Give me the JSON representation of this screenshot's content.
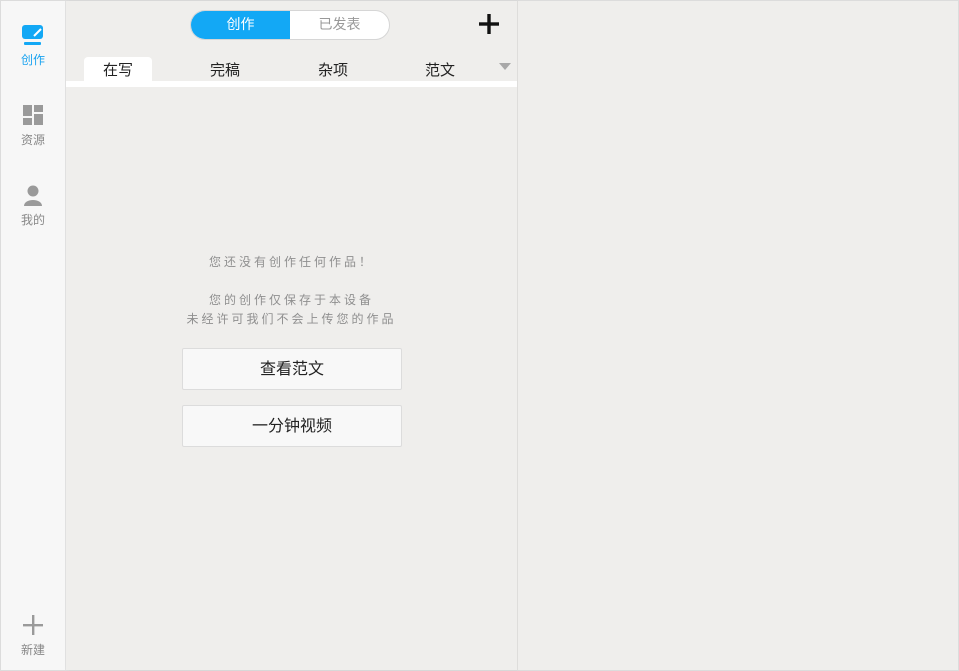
{
  "colors": {
    "accent": "#13a8f5",
    "icon_gray": "#999999"
  },
  "rail": {
    "items": [
      {
        "label": "创作",
        "icon": "edit-icon"
      },
      {
        "label": "资源",
        "icon": "dashboard-icon"
      },
      {
        "label": "我的",
        "icon": "user-icon"
      }
    ],
    "new_label": "新建"
  },
  "header": {
    "segments": [
      "创作",
      "已发表"
    ]
  },
  "tabs": [
    "在写",
    "完稿",
    "杂项",
    "范文"
  ],
  "empty": {
    "line1": "您还没有创作任何作品！",
    "line2": "您的创作仅保存于本设备",
    "line3": "未经许可我们不会上传您的作品"
  },
  "buttons": {
    "sample": "查看范文",
    "video": "一分钟视频"
  }
}
